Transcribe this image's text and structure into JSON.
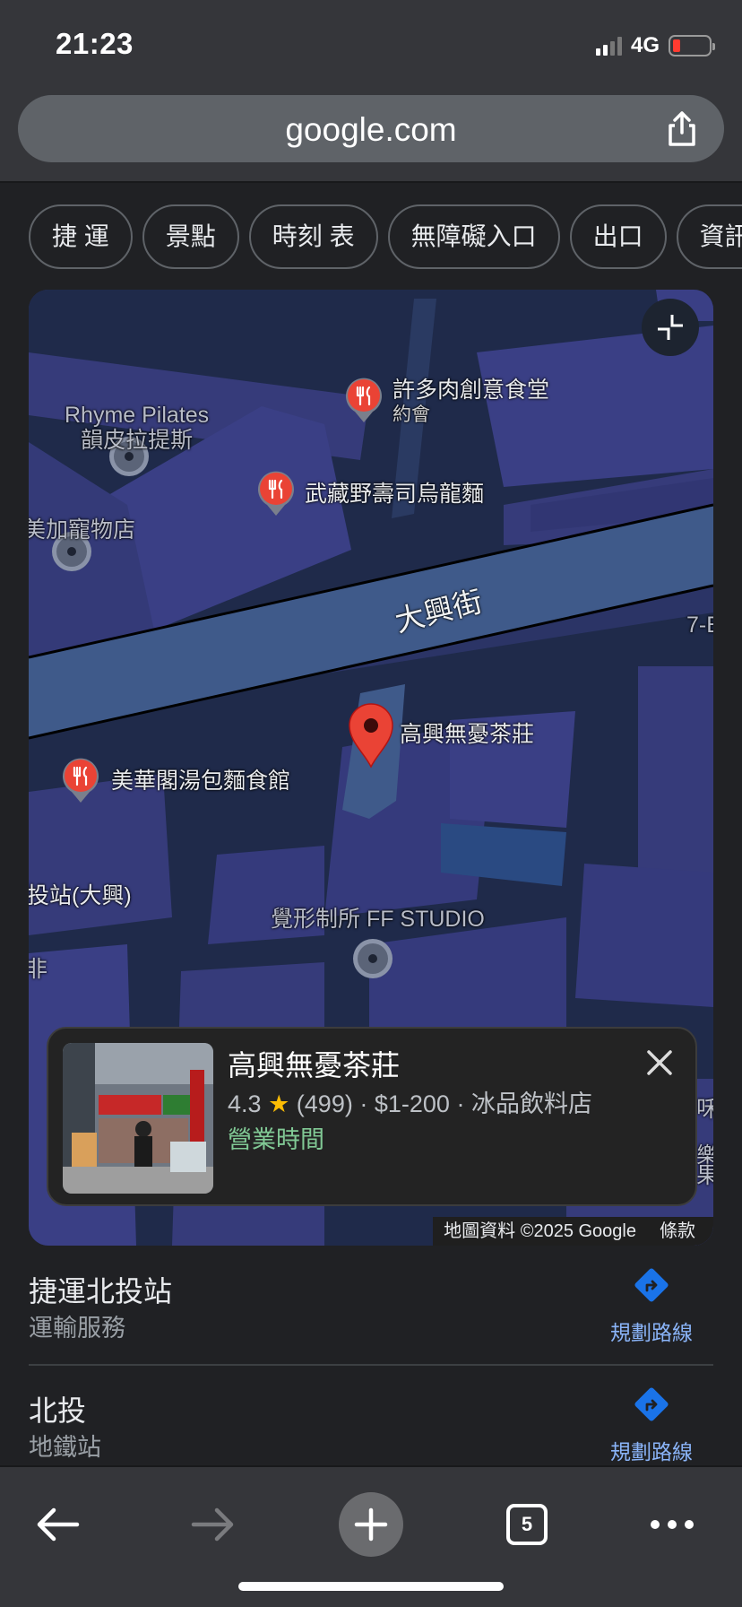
{
  "status": {
    "time": "21:23",
    "network": "4G"
  },
  "browser": {
    "url": "google.com",
    "tab_count": "5"
  },
  "chips": [
    "捷 運",
    "景點",
    "時刻 表",
    "無障礙入口",
    "出口",
    "資訊"
  ],
  "map": {
    "labels": {
      "rhyme_en": "Rhyme Pilates",
      "rhyme_zh": "韻皮拉提斯",
      "xu": "許多肉創意食堂",
      "xu_sub": "約會",
      "musashino": "武藏野壽司烏龍麵",
      "pet": "美加寵物店",
      "street": "大興街",
      "seven": "7-E",
      "gaoxing": "高興無憂茶莊",
      "meihua": "美華閣湯包麵食館",
      "station": "投站(大興)",
      "studio": "覺形制所 FF STUDIO",
      "fei": "非",
      "right_wei": "咊",
      "right_le": "樂",
      "right_guo": "果"
    },
    "attribution": "地圖資料 ©2025 Google",
    "terms": "條款"
  },
  "place_card": {
    "name": "高興無憂茶莊",
    "rating": "4.3",
    "star": "★",
    "reviews": "(499)",
    "price": "$1-200",
    "category": "冰品飲料店",
    "separator": "·",
    "hours": "營業時間"
  },
  "results": [
    {
      "title": "捷運北投站",
      "subtitle": "運輸服務",
      "action": "規劃路線"
    },
    {
      "title": "北投",
      "subtitle": "地鐵站",
      "action": "規劃路線"
    }
  ],
  "colors": {
    "accent_blue": "#8ab4f8",
    "open_green": "#81c995",
    "pin_red": "#ea4335",
    "star": "#fbbc04"
  }
}
